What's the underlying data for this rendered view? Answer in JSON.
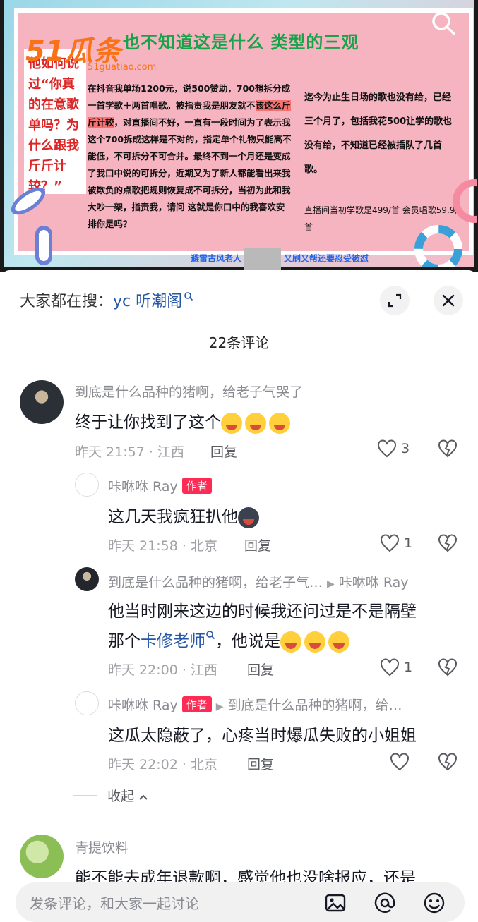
{
  "media": {
    "logo": "51瓜条",
    "logo_sub": "51guatiao.com",
    "title": "也不知道这是什么 类型的三观",
    "left_card": "他如何说过“你真的在意歌单吗？为什么跟我斤斤计较？”",
    "mid_text_1": "在抖音我单场1200元，说500赞助，700想拆分成一首学歌＋两首唱歌。被指责我是朋友就不",
    "mid_highlight": "该这么斤斤计较",
    "mid_text_2": "，对直播间不好，一直有一段时间为了表示我这个700拆成这样是不对的，指定单个礼物只能高不能低，不可拆分不可合并。最终不到一个月还是变成了我口中说的可拆分，近期又为了新人都能看出来我被欺负的点歌把规则恢复成不可拆分，当初为此和我大吵一架，指责我，请问 这就是你口中的我喜欢安排你是吗？",
    "right_text": "迄今为止生日场的歌也没有给，已经三个月了，包括我花500让学的歌也没有给，不知道已经被插队了几首歌。",
    "right_small": "直播间当初学歌是499/首  会员唱歌59.9/首",
    "footer_left": "避雷古风老人",
    "footer_right": "又刷又帮还要忍受被怼"
  },
  "sheet": {
    "search_prefix": "大家都在搜：",
    "search_keyword": "yc 听潮阁",
    "count_label": "22条评论"
  },
  "comments": [
    {
      "name": "到底是什么品种的猪啊，给老子气哭了",
      "text": "终于让你找到了这个",
      "time_loc": "昨天 21:57 · 江西",
      "reply": "回复",
      "likes": "3"
    },
    {
      "name": "咔咻咻 Ray",
      "badge": "作者",
      "text": "这几天我疯狂扒他",
      "time_loc": "昨天 21:58 · 北京",
      "reply": "回复",
      "likes": "1"
    },
    {
      "name": "到底是什么品种的猪啊，给老子气…",
      "reply_to": "咔咻咻 Ray",
      "text_line1": "他当时刚来这边的时候我还问过是不是隔壁",
      "text_pre": "那个",
      "text_link": "卡修老师",
      "text_post": "，他说是",
      "time_loc": "昨天 22:00 · 江西",
      "reply": "回复",
      "likes": "1"
    },
    {
      "name": "咔咻咻 Ray",
      "badge": "作者",
      "reply_to": "到底是什么品种的猪啊，给…",
      "text": "这瓜太隐蔽了，心疼当时爆瓜失败的小姐姐",
      "time_loc": "昨天 22:02 · 北京",
      "reply": "回复",
      "likes": ""
    }
  ],
  "collapse_label": "收起",
  "next_comment": {
    "name": "青提饮料",
    "text": "能不能去成年退款啊，感觉他也没啥报应，还是"
  },
  "input": {
    "placeholder": "发条评论，和大家一起讨论"
  },
  "colors": {
    "accent_red": "#fe2c55",
    "link_blue": "#2557a7"
  }
}
